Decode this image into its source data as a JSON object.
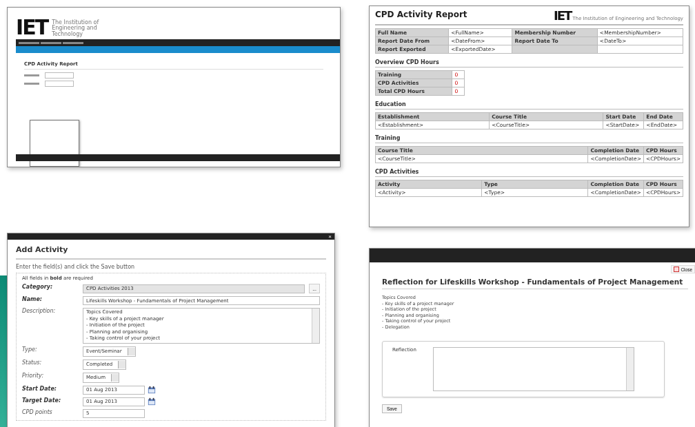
{
  "portal_screen": {
    "logo": "IET",
    "logo_tagline": "The Institution of Engineering and Technology",
    "page_title": "CPD Activity Report"
  },
  "report_screen": {
    "title": "CPD Activity Report",
    "logo": "IET",
    "logo_tagline": "The Institution of Engineering and Technology",
    "details": [
      {
        "label": "Full Name",
        "value": "<FullName>",
        "label_2": "Membership Number",
        "value_2": "<MembershipNumber>"
      },
      {
        "label": "Report Date From",
        "value": "<DateFrom>",
        "label_2": "Report Date To",
        "value_2": "<DateTo>"
      },
      {
        "label": "Report Exported",
        "value": "<ExportedDate>"
      }
    ],
    "overview": {
      "heading": "Overview CPD Hours",
      "rows": [
        {
          "label": "Training",
          "value": "0"
        },
        {
          "label": "CPD Activities",
          "value": "0"
        },
        {
          "label": "Total CPD Hours",
          "value": "0"
        }
      ]
    },
    "sections": [
      {
        "heading": "Education",
        "columns": [
          "Establishment",
          "Course Title",
          "Start Date",
          "End Date"
        ],
        "row": [
          "<Establishment>",
          "<CourseTitle>",
          "<StartDate>",
          "<EndDate>"
        ]
      },
      {
        "heading": "Training",
        "columns": [
          "Course Title",
          "Completion Date",
          "CPD Hours"
        ],
        "row": [
          "<CourseTitle>",
          "<CompletionDate>",
          "<CPDHours>"
        ]
      },
      {
        "heading": "CPD Activities",
        "columns": [
          "Activity",
          "Type",
          "Completion Date",
          "CPD Hours"
        ],
        "row": [
          "<Activity>",
          "<Type>",
          "<CompletionDate>",
          "<CPDHours>"
        ]
      }
    ]
  },
  "add_activity_dialog": {
    "close": "×",
    "title": "Add Activity",
    "instruction": "Enter the field(s) and click the Save button",
    "note": "All fields in **bold** are required",
    "fields": [
      {
        "kind": "lookup",
        "label": "Category:",
        "required": true,
        "value": "CPD Activities 2013",
        "button": "..."
      },
      {
        "kind": "text",
        "label": "Name:",
        "required": true,
        "value": "Lifeskills Workshop - Fundamentals of Project Management"
      },
      {
        "kind": "textarea",
        "label": "Description:",
        "required": false,
        "lines": [
          "Topics Covered",
          "- Key skills of a project manager",
          "- Initiation of the project",
          "- Planning and organising",
          "- Taking control of your project"
        ]
      },
      {
        "kind": "select",
        "label": "Type:",
        "required": false,
        "value": "Event/Seminar"
      },
      {
        "kind": "select",
        "label": "Status:",
        "required": false,
        "value": "Completed"
      },
      {
        "kind": "select",
        "label": "Priority:",
        "required": false,
        "value": "Medium"
      },
      {
        "kind": "date",
        "label": "Start Date:",
        "required": true,
        "value": "01 Aug 2013"
      },
      {
        "kind": "date",
        "label": "Target Date:",
        "required": true,
        "value": "01 Aug 2013"
      },
      {
        "kind": "text_short",
        "label": "CPD points",
        "required": false,
        "value": "5"
      }
    ]
  },
  "reflection_dialog": {
    "close": "Close",
    "title": "Reflection for Lifeskills Workshop - Fundamentals of Project Management",
    "topics": [
      "Topics Covered",
      "- Key skills of a project manager",
      "- Initiation of the project",
      "- Planning and organising",
      "- Taking control of your project",
      "- Delegation"
    ],
    "field_label": "Reflection",
    "save": "Save"
  }
}
